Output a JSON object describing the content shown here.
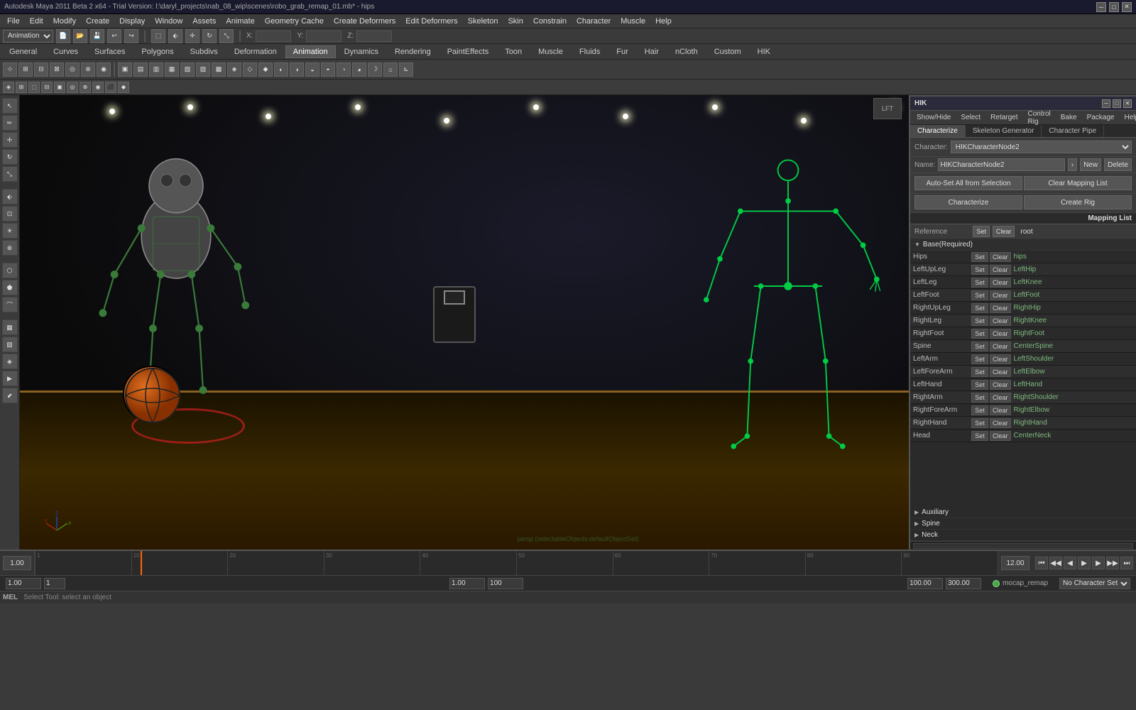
{
  "app": {
    "title": "Autodesk Maya 2011 Beta 2 x64 - Trial Version: l:\\daryl_projects\\nab_08_wip\\scenes\\robo_grab_remap_01.mb* - hips",
    "window_controls": [
      "minimize",
      "maximize",
      "close"
    ]
  },
  "menu": {
    "items": [
      "File",
      "Edit",
      "Modify",
      "Create",
      "Display",
      "Window",
      "Assets",
      "Animate",
      "Geometry Cache",
      "Create Deformers",
      "Edit Deformers",
      "Skeleton",
      "Skin",
      "Constrain",
      "Character",
      "Muscle",
      "Help"
    ]
  },
  "animation_dropdown": "Animation",
  "tabs": {
    "items": [
      "General",
      "Curves",
      "Surfaces",
      "Polygons",
      "Subdivs",
      "Deformation",
      "Animation",
      "Dynamics",
      "Rendering",
      "PaintEffects",
      "Toon",
      "Muscle",
      "Fluids",
      "Fur",
      "Hair",
      "nCloth",
      "Custom",
      "HIK"
    ],
    "active": "Animation"
  },
  "hik_panel": {
    "title": "HIK",
    "menu_items": [
      "Show/Hide",
      "Select",
      "Retarget",
      "Control Rig",
      "Bake",
      "Package",
      "Help"
    ],
    "tabs": [
      "Characterize",
      "Skeleton Generator",
      "Character Pipe"
    ],
    "active_tab": "Characterize",
    "character_label": "Character:",
    "character_value": "HIKCharacterNode2",
    "name_label": "Name:",
    "name_value": "HIKCharacterNode2",
    "buttons": {
      "new": "New",
      "delete": "Delete",
      "auto_set": "Auto-Set All from Selection",
      "clear_mapping": "Clear Mapping List",
      "characterize": "Characterize",
      "create_rig": "Create Rig",
      "mapping_list": "Mapping List"
    },
    "reference_row": {
      "label": "Reference",
      "set": "Set",
      "clear": "Clear",
      "value": "root"
    },
    "base_required": {
      "label": "Base(Required)",
      "rows": [
        {
          "name": "Hips",
          "set": "Set",
          "clear": "Clear",
          "value": "hips"
        },
        {
          "name": "LeftUpLeg",
          "set": "Set",
          "clear": "Clear",
          "value": "LeftHip"
        },
        {
          "name": "LeftLeg",
          "set": "Set",
          "clear": "Clear",
          "value": "LeftKnee"
        },
        {
          "name": "LeftFoot",
          "set": "Set",
          "clear": "Clear",
          "value": "LeftFoot"
        },
        {
          "name": "RightUpLeg",
          "set": "Set",
          "clear": "Clear",
          "value": "RightHip"
        },
        {
          "name": "RightLeg",
          "set": "Set",
          "clear": "Clear",
          "value": "RightKnee"
        },
        {
          "name": "RightFoot",
          "set": "Set",
          "clear": "Clear",
          "value": "RightFoot"
        },
        {
          "name": "Spine",
          "set": "Set",
          "clear": "Clear",
          "value": "CenterSpine"
        },
        {
          "name": "LeftArm",
          "set": "Set",
          "clear": "Clear",
          "value": "LeftShoulder"
        },
        {
          "name": "LeftForeArm",
          "set": "Set",
          "clear": "Clear",
          "value": "LeftElbow"
        },
        {
          "name": "LeftHand",
          "set": "Set",
          "clear": "Clear",
          "value": "LeftHand"
        },
        {
          "name": "RightArm",
          "set": "Set",
          "clear": "Clear",
          "value": "RightShoulder"
        },
        {
          "name": "RightForeArm",
          "set": "Set",
          "clear": "Clear",
          "value": "RightElbow"
        },
        {
          "name": "RightHand",
          "set": "Set",
          "clear": "Clear",
          "value": "RightHand"
        },
        {
          "name": "Head",
          "set": "Set",
          "clear": "Clear",
          "value": "CenterNeck"
        }
      ]
    },
    "auxiliary_label": "Auxiliary",
    "spine_label": "Spine",
    "neck_label": "Neck"
  },
  "status_bar": {
    "left_value": "1.00",
    "middle_value": "1",
    "range_start": "1.00",
    "range_end": "100",
    "time_start": "100.00",
    "time_end": "300.00",
    "fps_label": "mocap_remap",
    "character_set": "No Character Set",
    "frame_current": "12.00"
  },
  "bottom_bar": {
    "left_label": "MEL",
    "status_text": "Select Tool: select an object"
  },
  "playback": {
    "frame": "12.00",
    "buttons": [
      "⏮",
      "⏭",
      "◀◀",
      "◀",
      "▶",
      "▶▶",
      "⏭"
    ]
  },
  "viewport": {
    "label": "persp (selectableObjects:defaultObjectSet)"
  }
}
